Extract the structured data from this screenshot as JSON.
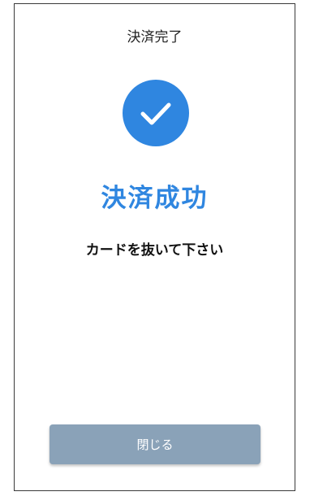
{
  "header": {
    "title": "決済完了"
  },
  "status": {
    "icon": "check-icon",
    "accent_color": "#2f86e0",
    "title": "決済成功",
    "message": "カードを抜いて下さい"
  },
  "footer": {
    "close_label": "閉じる",
    "button_color": "#8aa2b8"
  }
}
